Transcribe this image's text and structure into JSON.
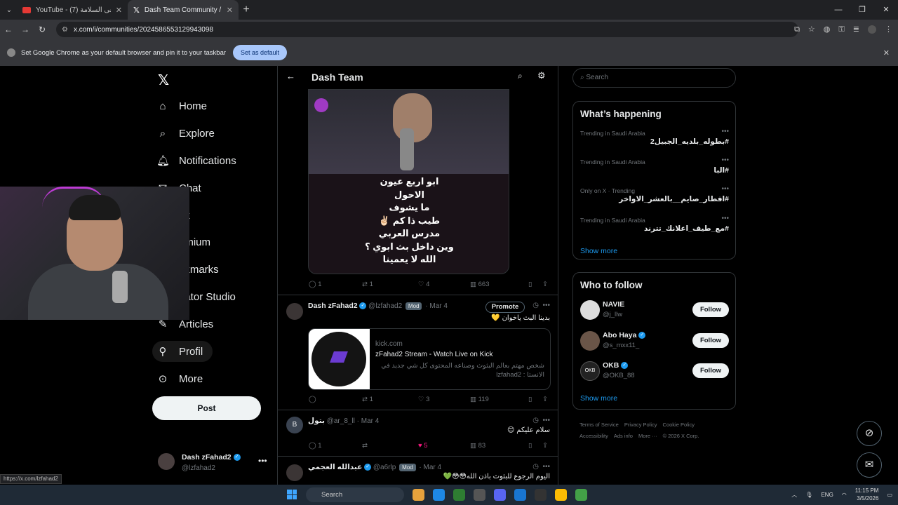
{
  "browser": {
    "tabs": [
      {
        "title": "YouTube - أبغى السلامة (7)"
      },
      {
        "title": "Dash Team Community / X"
      }
    ],
    "url": "x.com/i/communities/2024586553129943098",
    "infobar_text": "Set Google Chrome as your default browser and pin it to your taskbar",
    "infobar_button": "Set as default"
  },
  "nav": {
    "items": [
      {
        "label": "Home",
        "icon": "home-icon"
      },
      {
        "label": "Explore",
        "icon": "search-icon"
      },
      {
        "label": "Notifications",
        "icon": "bell-icon"
      },
      {
        "label": "Chat",
        "icon": "chat-icon"
      },
      {
        "label": "ok",
        "icon": "grok-icon"
      },
      {
        "label": "emium",
        "icon": "premium-icon"
      },
      {
        "label": "okmarks",
        "icon": "bookmark-icon"
      },
      {
        "label": "eator Studio",
        "icon": "creator-icon"
      },
      {
        "label": "Articles",
        "icon": "articles-icon"
      },
      {
        "label": "Profil",
        "icon": "profile-icon"
      },
      {
        "label": "More",
        "icon": "more-icon"
      }
    ],
    "post_button": "Post",
    "account": {
      "name": "Dash zFahad2",
      "handle": "@lzfahad2"
    }
  },
  "timeline": {
    "title": "Dash Team",
    "first_media_text": "ابو اربع عيون\nالاحول\nما يشوف\nطيب ذا كم ✌🏻\nمدرس العربي\nوين داخل بث ابوي ؟\nالله لا يعمينا",
    "first_stats": {
      "replies": "1",
      "reposts": "1",
      "likes": "4",
      "views": "663"
    },
    "posts": [
      {
        "name": "Dash zFahad2",
        "handle": "@lzfahad2",
        "badge": "Mod",
        "date": "· Mar 4",
        "promote": "Promote",
        "text": "بدينا البث ياخوان 💛",
        "card": {
          "domain": "kick.com",
          "title": "zFahad2 Stream - Watch Live on Kick",
          "desc": "شخص مهتم بعالم البثوث وصناعه المحتوى كل شي جديد في الانستا : lzfahad2"
        },
        "stats": {
          "replies": "",
          "reposts": "1",
          "likes": "3",
          "views": "119"
        }
      },
      {
        "name": "بتول",
        "handle": "@ar_8_ll",
        "date": "· Mar 4",
        "avatar_letter": "B",
        "text": "سلام عليكم 😊",
        "stats": {
          "replies": "1",
          "reposts": "",
          "likes": "5",
          "views": "83"
        }
      },
      {
        "name": "عبدالله العجمي",
        "handle": "@a6rlp",
        "badge": "Mod",
        "date": "· Mar 4",
        "text": "اليوم الرجوع للبثوث باذن الله😳😳💚"
      }
    ]
  },
  "sidebar": {
    "search_placeholder": "Search",
    "happening_title": "What’s happening",
    "trends": [
      {
        "context": "Trending in Saudi Arabia",
        "tag": "#بطوله_بلديه_الجبيل2"
      },
      {
        "context": "Trending in Saudi Arabia",
        "tag": "#البا"
      },
      {
        "context": "Only on X · Trending",
        "tag": "#افطار_صايم__بالعشر_الاواخر"
      },
      {
        "context": "Trending in Saudi Arabia",
        "tag": "#مع_طيف_اعلانك_تترند"
      }
    ],
    "show_more": "Show more",
    "follow_title": "Who to follow",
    "follows": [
      {
        "name": "NAVIE",
        "handle": "@j_llw",
        "button": "Follow"
      },
      {
        "name": "Abo Haya",
        "handle": "@s_mxx11_",
        "button": "Follow"
      },
      {
        "name": "OKB",
        "handle": "@OKB_88",
        "button": "Follow"
      }
    ],
    "show_more_2": "Show more",
    "footer": [
      "Terms of Service",
      "Privacy Policy",
      "Cookie Policy",
      "Accessibility",
      "Ads info",
      "More ···",
      "© 2026 X Corp."
    ]
  },
  "status_url": "https://x.com/lzfahad2",
  "taskbar": {
    "search": "Search",
    "lang": "ENG",
    "time": "11:15 PM",
    "date": "3/5/2026"
  }
}
